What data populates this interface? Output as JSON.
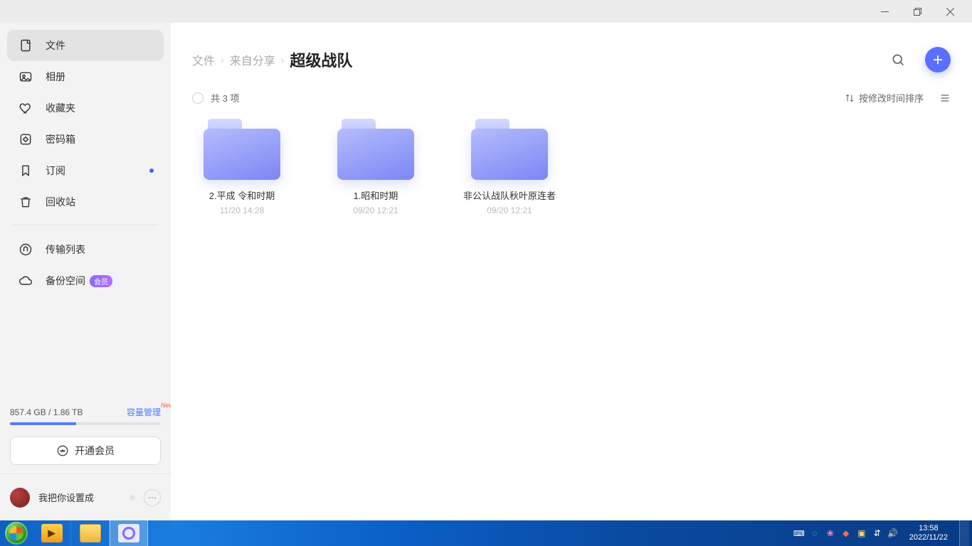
{
  "window": {
    "minimize": "–",
    "maximize": "❐",
    "close": "✕"
  },
  "sidebar": {
    "items": [
      {
        "label": "文件",
        "icon": "files"
      },
      {
        "label": "相册",
        "icon": "album"
      },
      {
        "label": "收藏夹",
        "icon": "favorites"
      },
      {
        "label": "密码箱",
        "icon": "safe"
      },
      {
        "label": "订阅",
        "icon": "bookmark",
        "dot": true
      },
      {
        "label": "回收站",
        "icon": "trash"
      }
    ],
    "secondary": [
      {
        "label": "传输列表",
        "icon": "transfer"
      },
      {
        "label": "备份空间",
        "icon": "cloud",
        "badge": "会员"
      }
    ]
  },
  "storage": {
    "used": "857.4 GB",
    "total": "1.86 TB",
    "text": "857.4 GB / 1.86 TB",
    "manage_label": "容量管理",
    "new_tag": "New",
    "percent": 44,
    "vip_button": "开通会员"
  },
  "user": {
    "name": "我把你设置成"
  },
  "breadcrumb": {
    "parts": [
      "文件",
      "来自分享"
    ],
    "current": "超级战队"
  },
  "toolbar": {
    "count_label": "共 3 项",
    "sort_label": "按修改时间排序"
  },
  "folders": [
    {
      "name": "2.平成 令和时期",
      "date": "11/20 14:28"
    },
    {
      "name": "1.昭和时期",
      "date": "09/20 12:21"
    },
    {
      "name": "非公认战队秋叶原连者",
      "date": "09/20 12:21"
    }
  ],
  "taskbar": {
    "time": "13:58",
    "date": "2022/11/22"
  }
}
